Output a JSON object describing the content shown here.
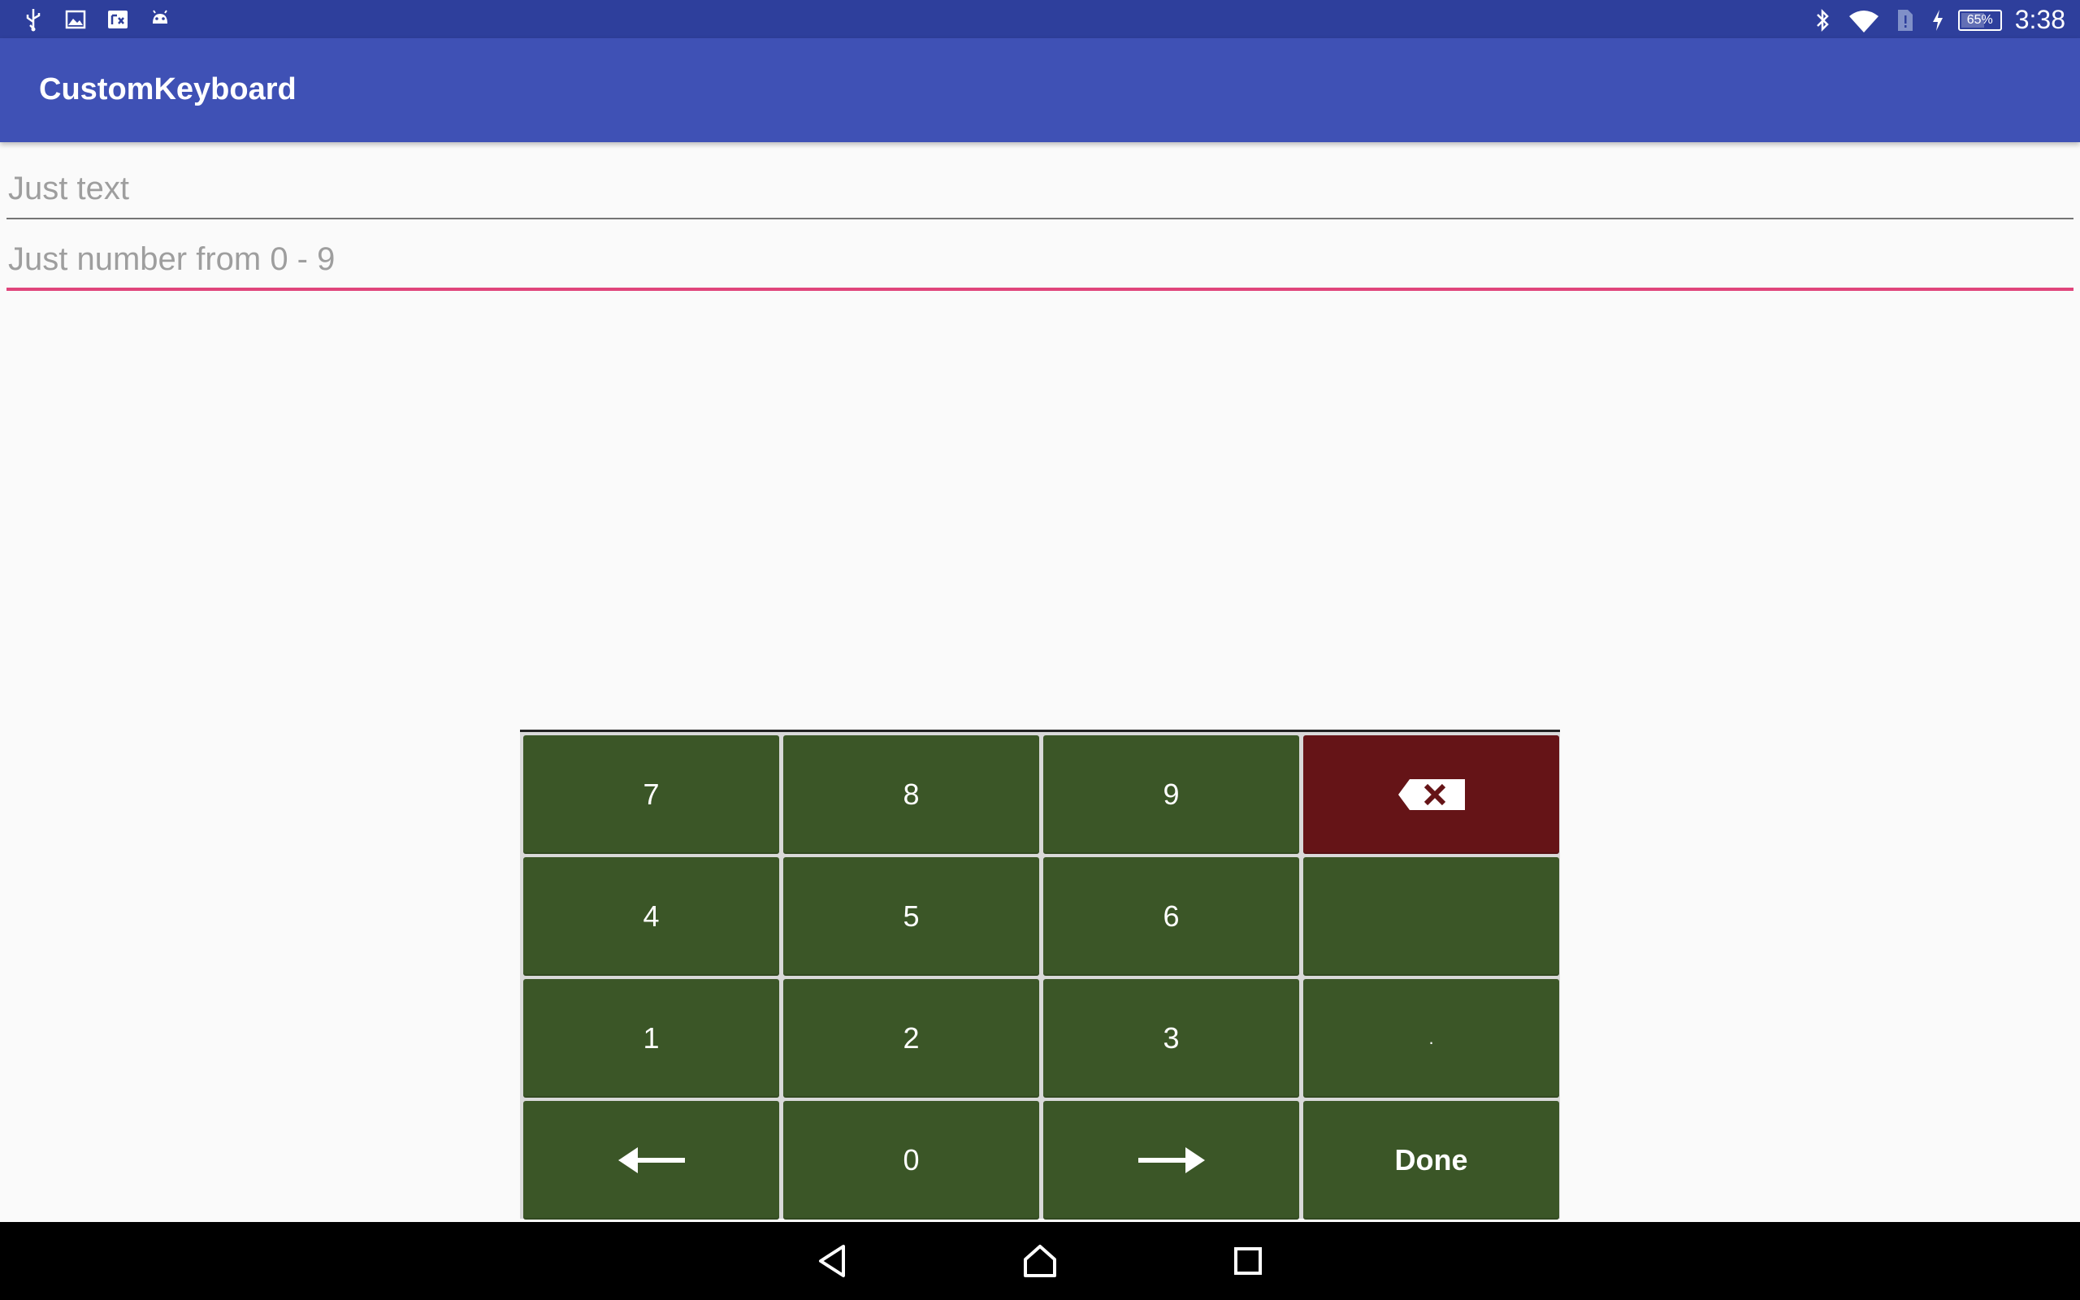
{
  "status_bar": {
    "left_icons": [
      "usb-icon",
      "image-icon",
      "news-icon",
      "android-icon"
    ],
    "right_icons": [
      "bluetooth-icon",
      "wifi-icon",
      "sim-alert-icon",
      "charging-icon"
    ],
    "battery_percent": "65%",
    "battery_level": 0.65,
    "time": "3:38"
  },
  "app_bar": {
    "title": "CustomKeyboard"
  },
  "fields": {
    "text_field": {
      "placeholder": "Just text",
      "value": ""
    },
    "number_field": {
      "placeholder": "Just number from 0 - 9",
      "value": ""
    }
  },
  "keyboard": {
    "rows": [
      [
        "7",
        "8",
        "9",
        "delete"
      ],
      [
        "4",
        "5",
        "6",
        ""
      ],
      [
        "1",
        "2",
        "3",
        "."
      ],
      [
        "left-arrow",
        "0",
        "right-arrow",
        "Done"
      ]
    ],
    "labels": {
      "k7": "7",
      "k8": "8",
      "k9": "9",
      "k4": "4",
      "k5": "5",
      "k6": "6",
      "k1": "1",
      "k2": "2",
      "k3": "3",
      "kdot": ".",
      "k0": "0",
      "done": "Done"
    },
    "colors": {
      "key": "#3b5627",
      "delete_key": "#651417",
      "background": "#d9d9d9"
    }
  },
  "nav_bar": {
    "buttons": [
      "back-icon",
      "home-icon",
      "recents-icon"
    ]
  },
  "colors": {
    "status_bar": "#2e3f9c",
    "app_bar": "#3f51b5",
    "focus_accent": "#e0457b"
  }
}
